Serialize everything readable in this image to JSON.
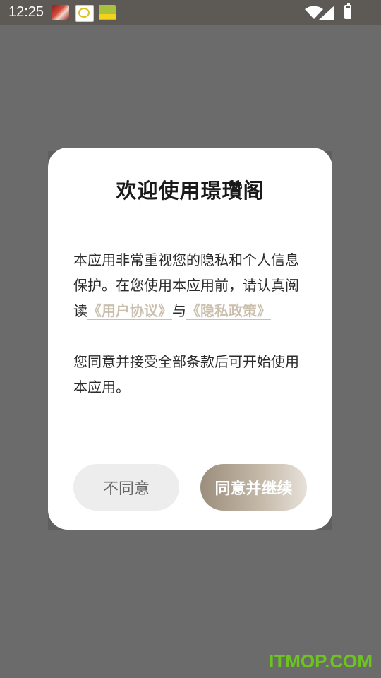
{
  "status_bar": {
    "time": "12:25",
    "notification_icons": [
      "red-app-icon",
      "yk-app-icon",
      "green-app-icon"
    ],
    "system_icons": [
      "wifi-icon",
      "signal-icon",
      "battery-icon"
    ]
  },
  "dialog": {
    "title": "欢迎使用璟瓚阁",
    "intro_text": "本应用非常重视您的隐私和个人信息保护。在您使用本应用前，请认真阅读",
    "user_agreement_link": "《用户协议》",
    "connector": "与",
    "privacy_policy_link": "《隐私政策》",
    "consent_text": "您同意并接受全部条款后可开始使用本应用。",
    "decline_label": "不同意",
    "accept_label": "同意并继续"
  },
  "watermark": "ITMOP.COM",
  "colors": {
    "overlay": "#6b6b6b",
    "link": "#cbbfae",
    "accept_gradient_start": "#9c8e7c",
    "accept_gradient_end": "#e7e1d8",
    "decline_bg": "#ededed",
    "watermark": "#6cc51e"
  }
}
